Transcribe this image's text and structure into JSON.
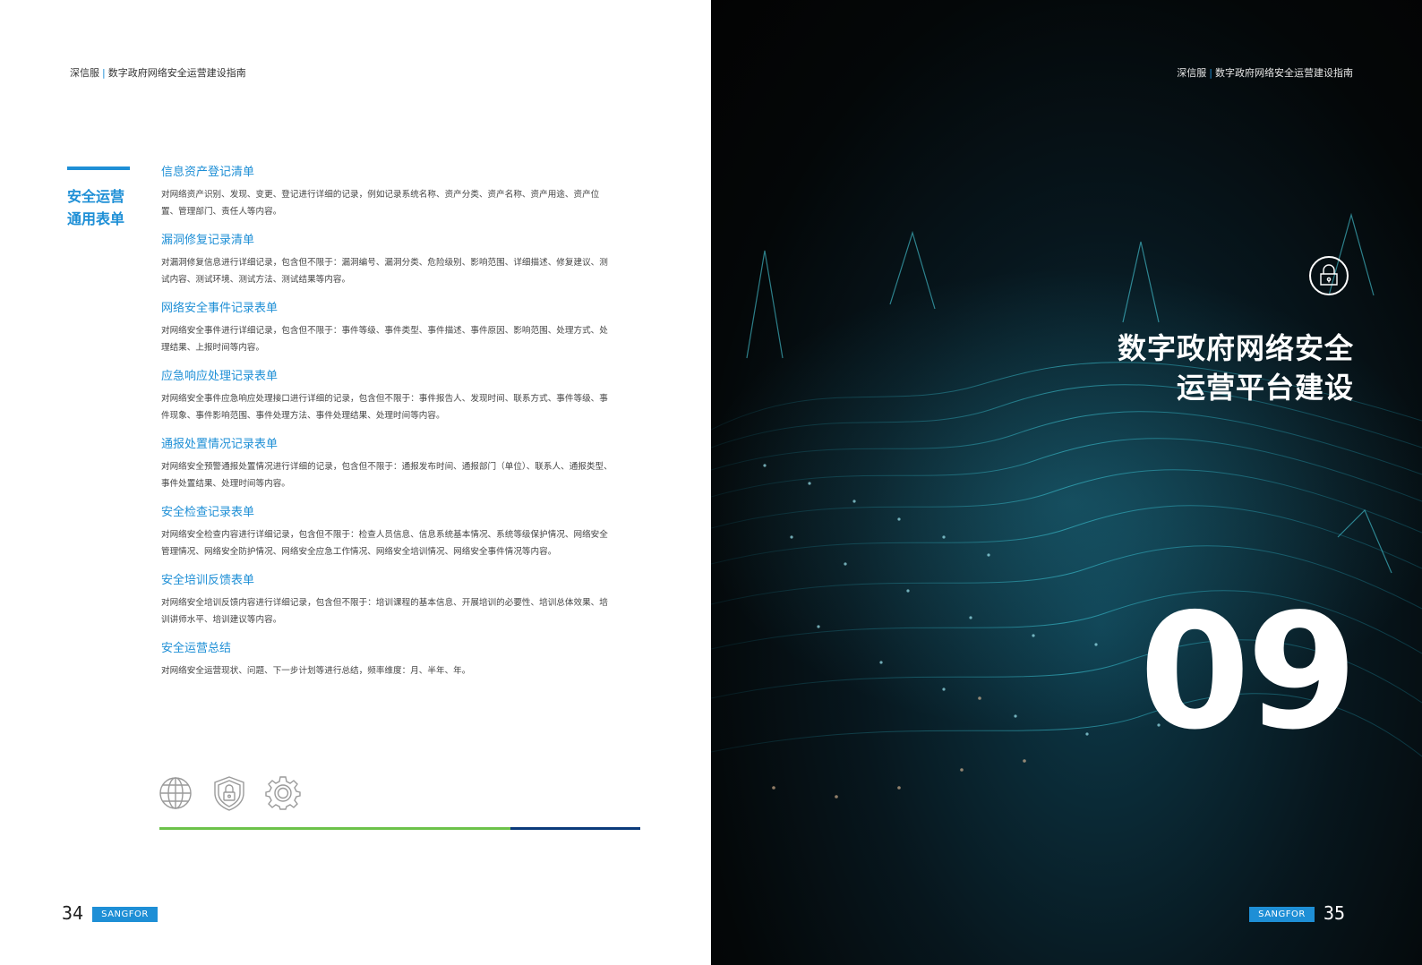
{
  "left_page": {
    "header": {
      "brand": "深信服",
      "separator": "|",
      "title": "数字政府网络安全运营建设指南"
    },
    "side_title": {
      "line1": "安全运营",
      "line2": "通用表单"
    },
    "sections": [
      {
        "heading": "信息资产登记清单",
        "body": "对网络资产识别、发现、变更、登记进行详细的记录，例如记录系统名称、资产分类、资产名称、资产用途、资产位置、管理部门、责任人等内容。"
      },
      {
        "heading": "漏洞修复记录清单",
        "body": "对漏洞修复信息进行详细记录，包含但不限于：漏洞编号、漏洞分类、危险级别、影响范围、详细描述、修复建议、测试内容、测试环境、测试方法、测试结果等内容。"
      },
      {
        "heading": "网络安全事件记录表单",
        "body": "对网络安全事件进行详细记录，包含但不限于：事件等级、事件类型、事件描述、事件原因、影响范围、处理方式、处理结果、上报时间等内容。"
      },
      {
        "heading": "应急响应处理记录表单",
        "body": "对网络安全事件应急响应处理接口进行详细的记录，包含但不限于：事件报告人、发现时间、联系方式、事件等级、事件现象、事件影响范围、事件处理方法、事件处理结果、处理时间等内容。"
      },
      {
        "heading": "通报处置情况记录表单",
        "body": "对网络安全预警通报处置情况进行详细的记录，包含但不限于：通报发布时间、通报部门（单位）、联系人、通报类型、事件处置结果、处理时间等内容。"
      },
      {
        "heading": "安全检查记录表单",
        "body": "对网络安全检查内容进行详细记录，包含但不限于：检查人员信息、信息系统基本情况、系统等级保护情况、网络安全管理情况、网络安全防护情况、网络安全应急工作情况、网络安全培训情况、网络安全事件情况等内容。"
      },
      {
        "heading": "安全培训反馈表单",
        "body": "对网络安全培训反馈内容进行详细记录，包含但不限于：培训课程的基本信息、开展培训的必要性、培训总体效果、培训讲师水平、培训建议等内容。"
      },
      {
        "heading": "安全运营总结",
        "body": "对网络安全运营现状、问题、下一步计划等进行总结，频率维度：月、半年、年。"
      }
    ],
    "icons": [
      "globe-icon",
      "shield-lock-icon",
      "gear-icon"
    ],
    "page_number": "34",
    "brand_tag": "SANGFOR"
  },
  "right_page": {
    "header": {
      "brand": "深信服",
      "separator": "|",
      "title": "数字政府网络安全运营建设指南"
    },
    "chapter_title": {
      "line1": "数字政府网络安全",
      "line2": "运营平台建设"
    },
    "chapter_number": "09",
    "page_number": "35",
    "brand_tag": "SANGFOR"
  },
  "colors": {
    "accent": "#1e8fd6",
    "green": "#6cc24a",
    "navy": "#0b3a7a"
  }
}
